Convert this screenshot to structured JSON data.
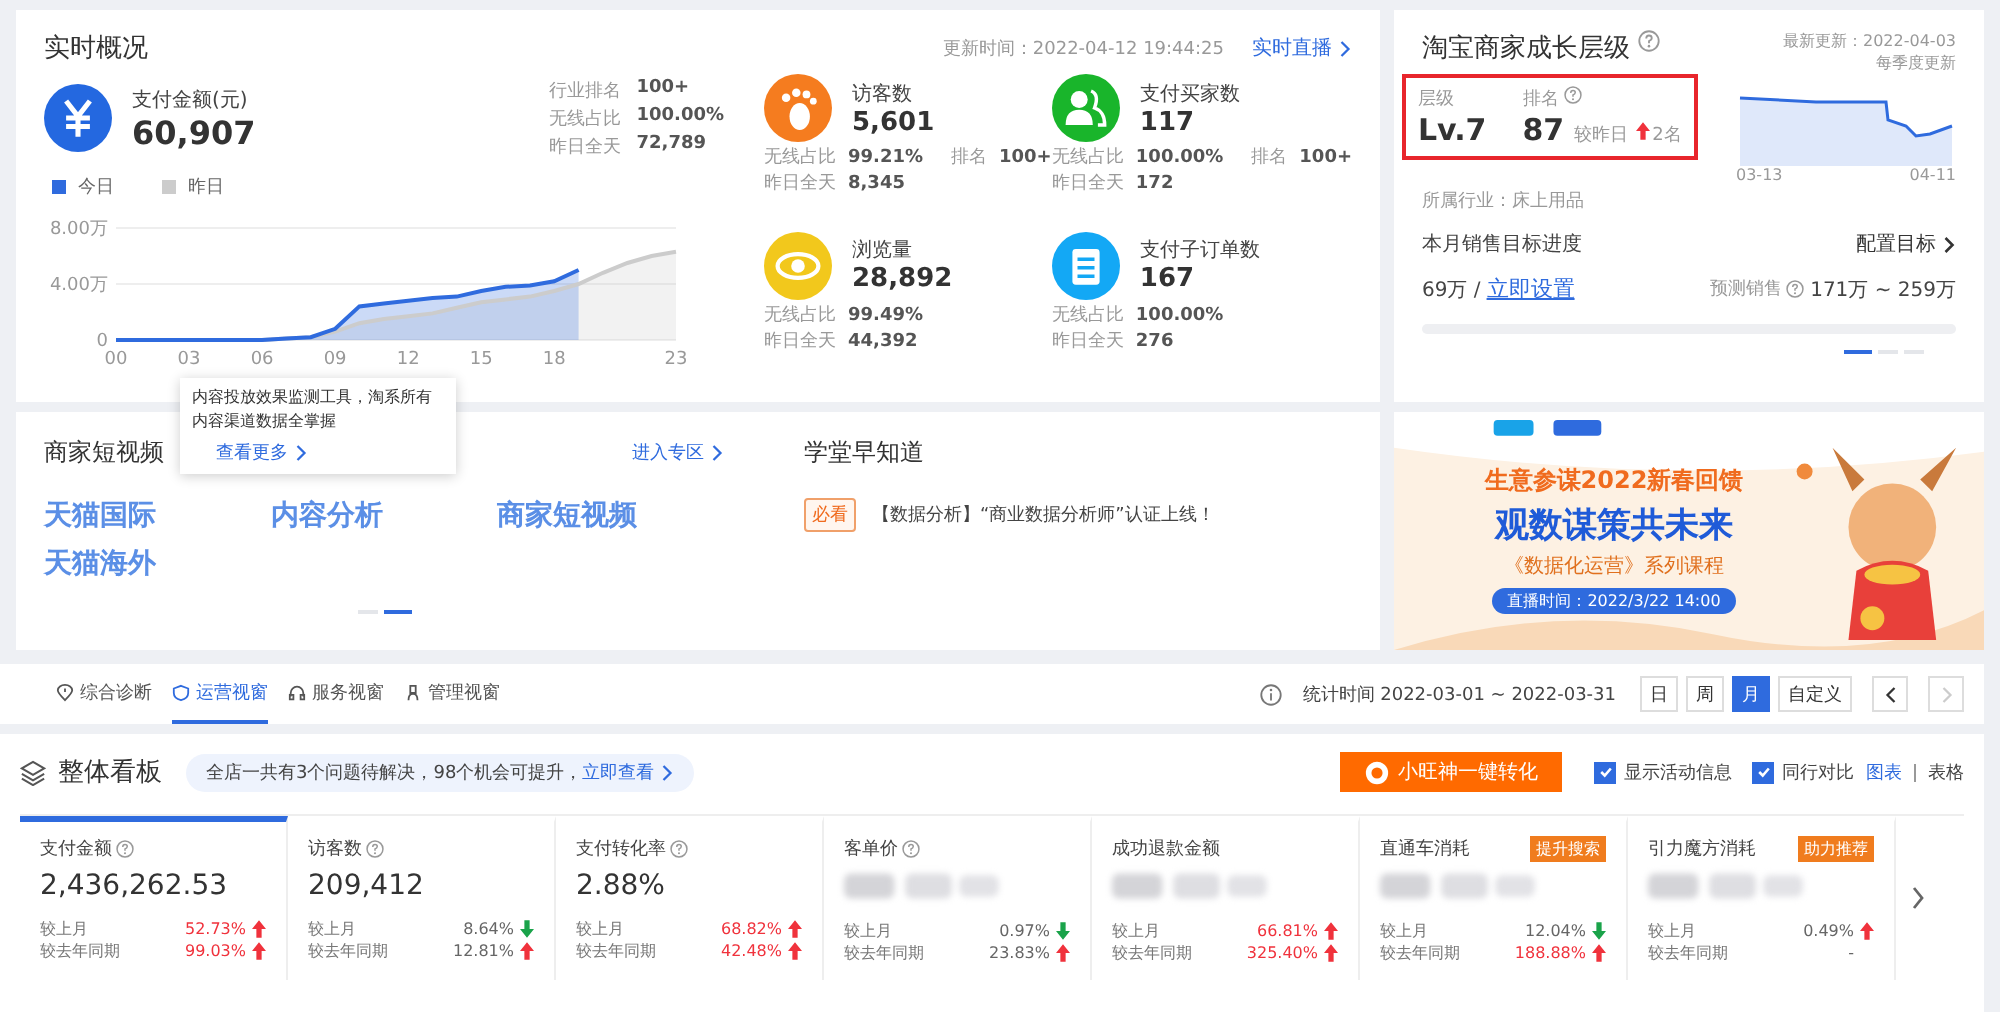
{
  "realtime": {
    "title": "实时概况",
    "update_time": "更新时间：2022-04-12 19:44:25",
    "live_link": "实时直播",
    "main": {
      "label": "支付金额(元)",
      "value": "60,907",
      "stats": [
        {
          "label": "行业排名",
          "value": "100+"
        },
        {
          "label": "无线占比",
          "value": "100.00%"
        },
        {
          "label": "昨日全天",
          "value": "72,789"
        }
      ]
    },
    "chart_data": {
      "type": "area",
      "x": [
        0,
        1,
        2,
        3,
        4,
        5,
        6,
        7,
        8,
        9,
        10,
        11,
        12,
        13,
        14,
        15,
        16,
        17,
        18,
        19,
        20,
        21,
        22,
        23
      ],
      "xticks": [
        {
          "value": 0,
          "label": "00"
        },
        {
          "value": 3,
          "label": "03"
        },
        {
          "value": 6,
          "label": "06"
        },
        {
          "value": 9,
          "label": "09"
        },
        {
          "value": 12,
          "label": "12"
        },
        {
          "value": 15,
          "label": "15"
        },
        {
          "value": 18,
          "label": "18"
        },
        {
          "value": 23,
          "label": "23"
        }
      ],
      "xlim": [
        0,
        23
      ],
      "yticks": [
        {
          "value": 0,
          "label": "0"
        },
        {
          "value": 4,
          "label": "4.00万"
        },
        {
          "value": 8,
          "label": "8.00万"
        }
      ],
      "ylim": [
        0,
        8
      ],
      "series": [
        {
          "name": "今日",
          "color": "#2f6bde",
          "values": [
            0,
            0,
            0,
            0,
            0,
            0,
            0,
            0.1,
            0.2,
            0.8,
            2.4,
            2.6,
            2.8,
            3,
            3.1,
            3.5,
            3.8,
            3.9,
            4.2,
            5,
            null,
            null,
            null,
            null
          ]
        },
        {
          "name": "昨日",
          "color": "#cccccc",
          "values": [
            0,
            0,
            0,
            0,
            0,
            0,
            0,
            0.1,
            0.2,
            0.6,
            1.2,
            1.5,
            1.7,
            1.9,
            2.3,
            2.7,
            2.9,
            3.1,
            3.5,
            4,
            4.8,
            5.5,
            6,
            6.3
          ]
        }
      ]
    },
    "metrics": [
      {
        "kind": "footprint",
        "label": "访客数",
        "value": "5,601",
        "color": "#f57c1f",
        "stats": [
          {
            "label": "无线占比",
            "value": "99.21%",
            "rank_label": "排名",
            "rank": "100+"
          },
          {
            "label": "昨日全天",
            "value": "8,345"
          }
        ]
      },
      {
        "kind": "people",
        "label": "支付买家数",
        "value": "117",
        "color": "#19b52b",
        "stats": [
          {
            "label": "无线占比",
            "value": "100.00%",
            "rank_label": "排名",
            "rank": "100+"
          },
          {
            "label": "昨日全天",
            "value": "172"
          }
        ]
      },
      {
        "kind": "eye",
        "label": "浏览量",
        "value": "28,892",
        "color": "#f2c81c",
        "stats": [
          {
            "label": "无线占比",
            "value": "99.49%"
          },
          {
            "label": "昨日全天",
            "value": "44,392"
          }
        ]
      },
      {
        "kind": "clipboard",
        "label": "支付子订单数",
        "value": "167",
        "color": "#13a8f5",
        "stats": [
          {
            "label": "无线占比",
            "value": "100.00%"
          },
          {
            "label": "昨日全天",
            "value": "276"
          }
        ]
      }
    ]
  },
  "growth": {
    "title": "淘宝商家成长层级",
    "update": "最新更新：2022-04-03",
    "update_note": "每季度更新",
    "highlighted": true,
    "level_label": "层级",
    "level": "Lv.7",
    "rank_label": "排名",
    "rank": "87",
    "rank_change_label": "较昨日",
    "rank_change": "2名",
    "rank_rising": true,
    "chart_labels": [
      "03-13",
      "04-11"
    ],
    "industry": "所属行业：床上用品",
    "target_title": "本月销售目标进度",
    "config_link": "配置目标",
    "sales": "69万 /",
    "set_link": "立即设置",
    "forecast_label": "预测销售",
    "forecast": "171万 ~ 259万",
    "progress": {
      "level": 0
    },
    "pager": [
      {
        "selected": true
      },
      {
        "selected": false
      },
      {
        "selected": false
      }
    ]
  },
  "video": {
    "title": "商家短视频",
    "enter_link": "进入专区",
    "links": [
      "天猫国际",
      "内容分析",
      "商家短视频",
      "天猫海外"
    ],
    "pager": [
      {
        "selected": false
      },
      {
        "selected": true
      }
    ]
  },
  "tooltip": {
    "text": "内容投放效果监测工具，淘系所有内容渠道数据全掌握",
    "link": "查看更多"
  },
  "school": {
    "title": "学堂早知道",
    "items": [
      {
        "tag": "必看",
        "text": "【数据分析】“商业数据分析师”认证上线！"
      }
    ]
  },
  "banner": {
    "headline": "生意参谋2022新春回馈",
    "title": "观数谋策共未来",
    "subtitle": "《数据化运营》系列课程",
    "time": "直播时间：2022/3/22 14:00"
  },
  "view_tabs": [
    {
      "kind": "pin",
      "label": "综合诊断",
      "selected": false
    },
    {
      "kind": "shield",
      "label": "运营视窗",
      "selected": true
    },
    {
      "kind": "headset",
      "label": "服务视窗",
      "selected": false
    },
    {
      "kind": "person",
      "label": "管理视窗",
      "selected": false
    }
  ],
  "stat_period": "统计时间 2022-03-01 ~ 2022-03-31",
  "periods": [
    {
      "label": "日",
      "selected": false
    },
    {
      "label": "周",
      "selected": false
    },
    {
      "label": "月",
      "selected": true
    },
    {
      "label": "自定义",
      "selected": false
    }
  ],
  "board": {
    "title": "整体看板",
    "notice": "全店一共有3个问题待解决，98个机会可提升，",
    "notice_link": "立即查看",
    "action": "小旺神一键转化",
    "options": [
      {
        "label": "显示活动信息",
        "checked": true
      },
      {
        "label": "同行对比",
        "checked": true
      }
    ],
    "views": [
      {
        "label": "图表",
        "selected": true
      },
      {
        "label": "表格",
        "selected": false
      }
    ],
    "metrics": [
      {
        "label": "支付金额",
        "help": true,
        "value": "2,436,262.53",
        "selected": true,
        "compare": [
          {
            "label": "较上月",
            "value": "52.73%",
            "kind": "rise",
            "emphasis": true
          },
          {
            "label": "较去年同期",
            "value": "99.03%",
            "kind": "rise",
            "emphasis": true
          }
        ]
      },
      {
        "label": "访客数",
        "help": true,
        "value": "209,412",
        "selected": false,
        "compare": [
          {
            "label": "较上月",
            "value": "8.64%",
            "kind": "fall",
            "emphasis": false
          },
          {
            "label": "较去年同期",
            "value": "12.81%",
            "kind": "rise",
            "emphasis": false
          }
        ]
      },
      {
        "label": "支付转化率",
        "help": true,
        "value": "2.88%",
        "selected": false,
        "compare": [
          {
            "label": "较上月",
            "value": "68.82%",
            "kind": "rise",
            "emphasis": true
          },
          {
            "label": "较去年同期",
            "value": "42.48%",
            "kind": "rise",
            "emphasis": true
          }
        ]
      },
      {
        "label": "客单价",
        "help": true,
        "value_hidden": true,
        "selected": false,
        "compare": [
          {
            "label": "较上月",
            "value": "0.97%",
            "kind": "fall",
            "emphasis": false
          },
          {
            "label": "较去年同期",
            "value": "23.83%",
            "kind": "rise",
            "emphasis": false
          }
        ]
      },
      {
        "label": "成功退款金额",
        "help": false,
        "value_hidden": true,
        "selected": false,
        "compare": [
          {
            "label": "较上月",
            "value": "66.81%",
            "kind": "rise",
            "emphasis": true
          },
          {
            "label": "较去年同期",
            "value": "325.40%",
            "kind": "rise",
            "emphasis": true
          }
        ]
      },
      {
        "label": "直通车消耗",
        "help": false,
        "badge": "提升搜索",
        "value_hidden": true,
        "selected": false,
        "compare": [
          {
            "label": "较上月",
            "value": "12.04%",
            "kind": "fall",
            "emphasis": false
          },
          {
            "label": "较去年同期",
            "value": "188.88%",
            "kind": "rise",
            "emphasis": true
          }
        ]
      },
      {
        "label": "引力魔方消耗",
        "help": false,
        "badge": "助力推荐",
        "value_hidden": true,
        "selected": false,
        "compare": [
          {
            "label": "较上月",
            "value": "0.49%",
            "kind": "rise",
            "emphasis": false
          },
          {
            "label": "较去年同期",
            "value": "-",
            "kind": "flat",
            "emphasis": false
          }
        ]
      }
    ]
  }
}
